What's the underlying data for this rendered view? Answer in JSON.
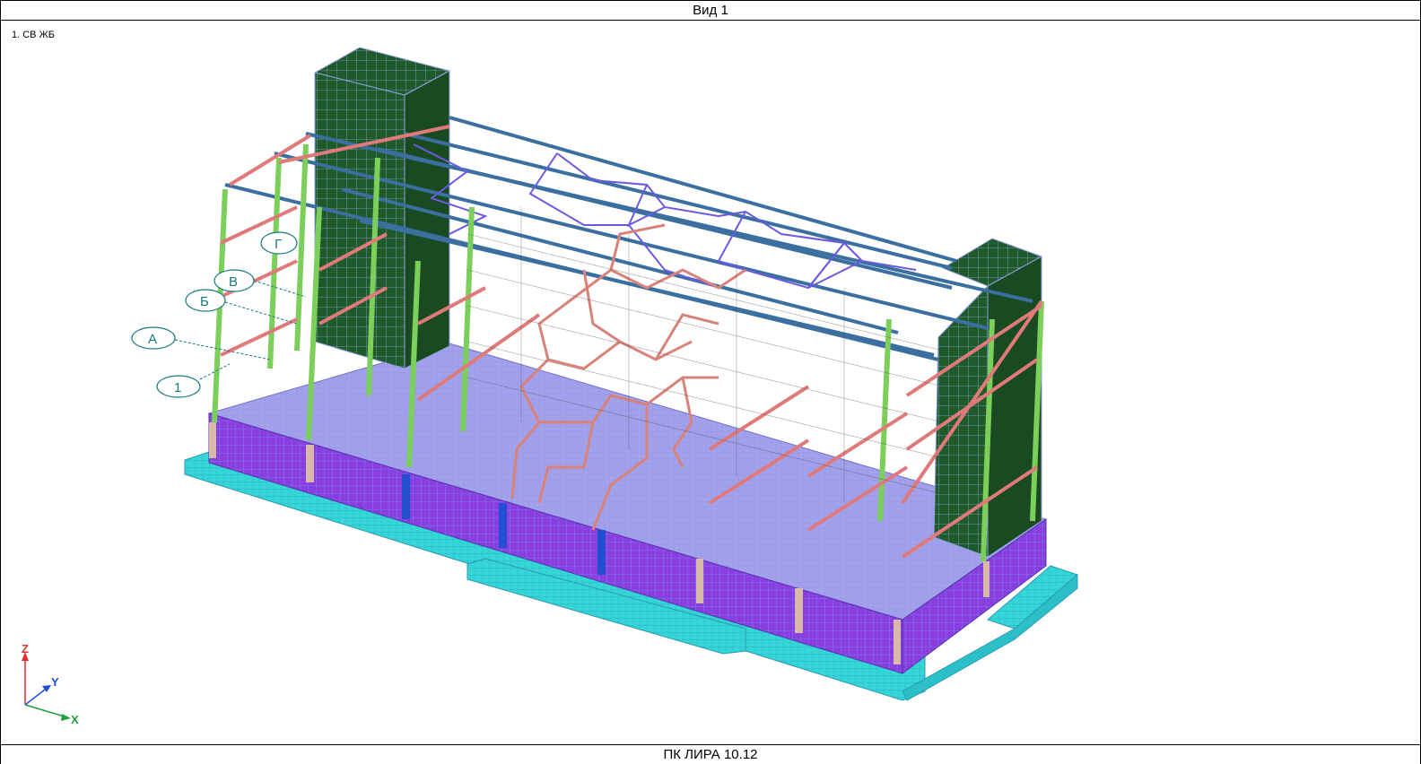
{
  "window": {
    "title": "Вид 1",
    "view_label": "1. СВ ЖБ"
  },
  "status": {
    "text": "ПК ЛИРА 10.12"
  },
  "axes": {
    "z": "Z",
    "y": "Y",
    "x": "X",
    "colors": {
      "z": "#e03030",
      "y": "#2050e0",
      "x": "#20a040"
    }
  },
  "grid_axes": {
    "labels": [
      "Г",
      "В",
      "Б",
      "А",
      "1"
    ]
  },
  "model_colors": {
    "foundation": "#35d6d6",
    "wall": "#8a3ee0",
    "slab": "#9a9ae8",
    "core": "#1f5a2a",
    "column": "#7ccf5a",
    "beam": "#e07a7a",
    "truss": "#3a6fa0",
    "brace": "#6a5ae0"
  }
}
